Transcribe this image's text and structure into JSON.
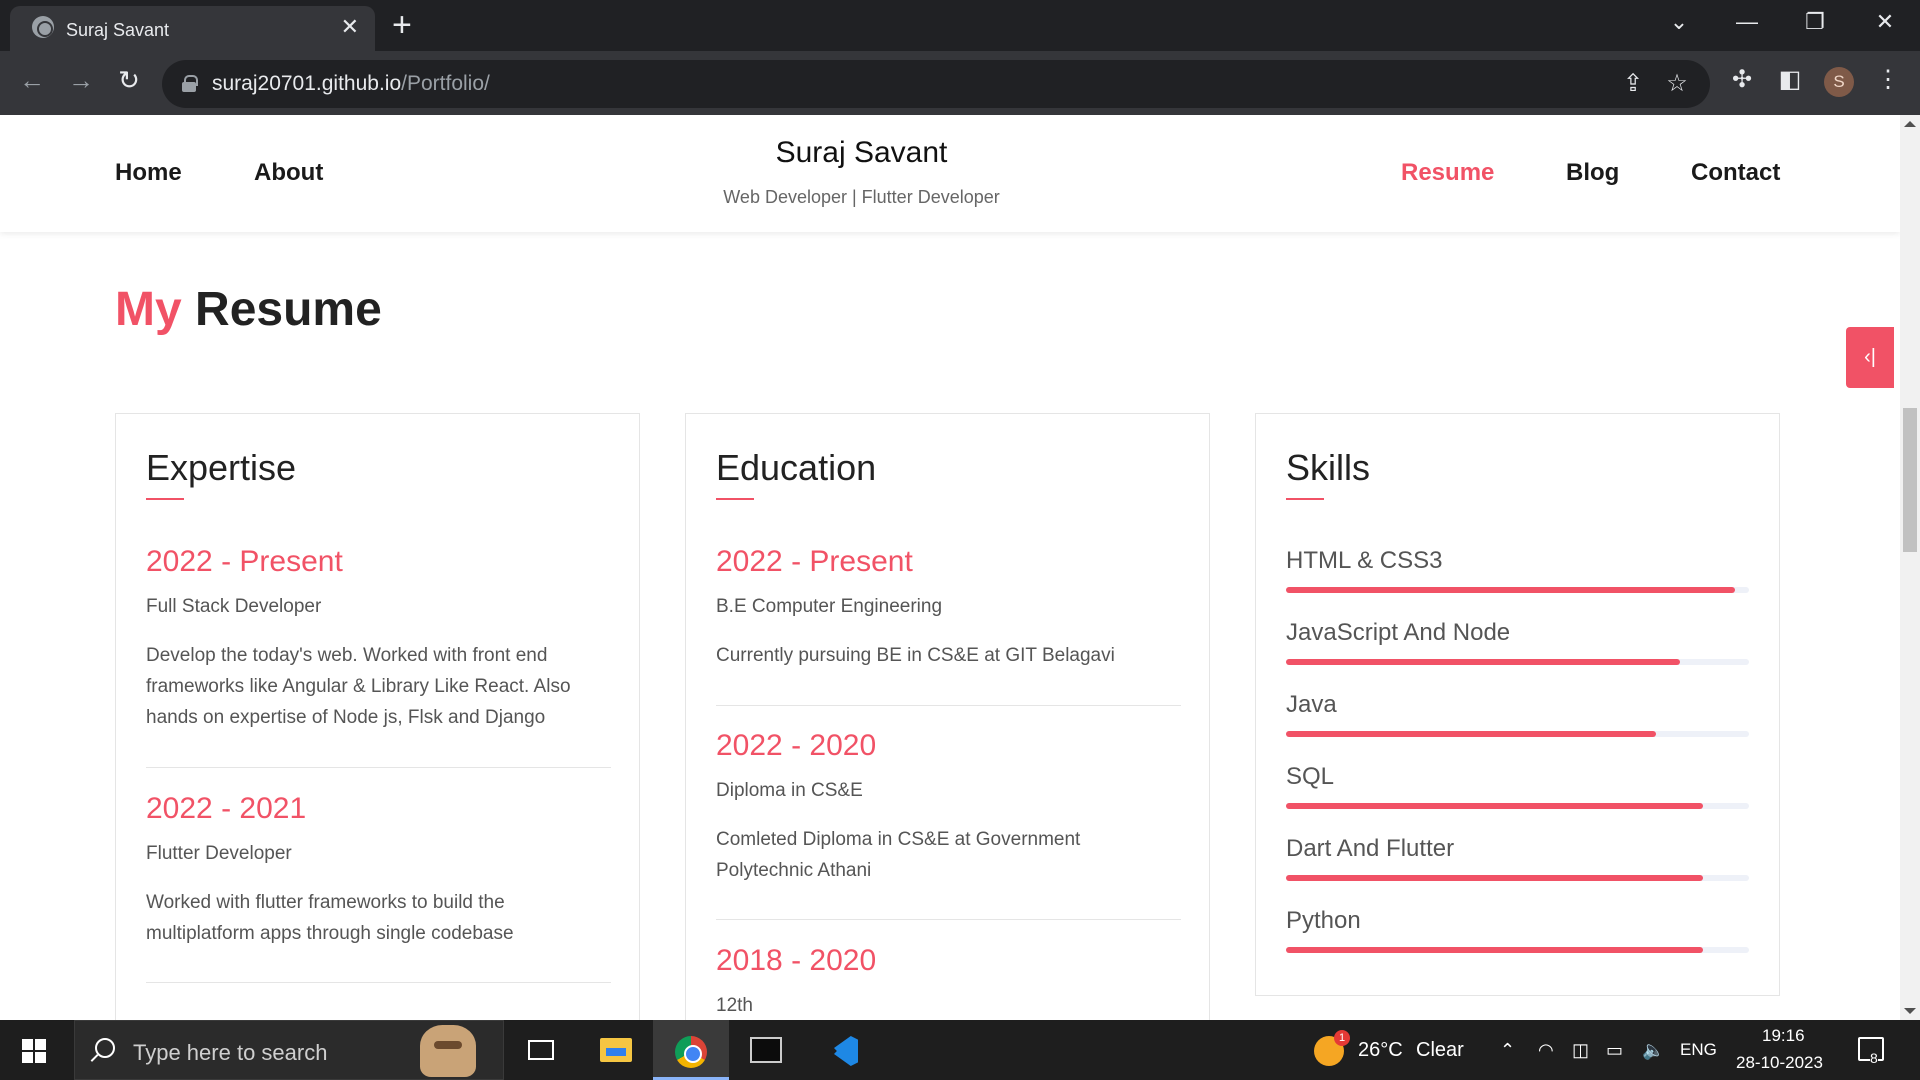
{
  "browser": {
    "tab_title": "Suraj Savant",
    "url_domain": "suraj20701.github.io",
    "url_path": "/Portfolio/",
    "profile_initial": "S"
  },
  "site": {
    "brand_name": "Suraj Savant",
    "brand_sub": "Web Developer | Flutter Developer",
    "nav": {
      "home": "Home",
      "about": "About",
      "resume": "Resume",
      "blog": "Blog",
      "contact": "Contact"
    },
    "section_title_accent": "My",
    "section_title_rest": "Resume",
    "accent_color": "#f15266"
  },
  "expertise": {
    "title": "Expertise",
    "entries": [
      {
        "year": "2022 - Present",
        "role": "Full Stack Developer",
        "desc": "Develop the today's web. Worked with front end frameworks like Angular & Library Like React. Also hands on expertise of Node js, Flsk and Django"
      },
      {
        "year": "2022 - 2021",
        "role": "Flutter Developer",
        "desc": "Worked with flutter frameworks to build the multiplatform apps through single codebase"
      }
    ]
  },
  "education": {
    "title": "Education",
    "entries": [
      {
        "year": "2022 - Present",
        "role": "B.E Computer Engineering",
        "desc": "Currently pursuing BE in CS&E at GIT Belagavi"
      },
      {
        "year": "2022 - 2020",
        "role": "Diploma in CS&E",
        "desc": "Comleted Diploma in CS&E at Government Polytechnic Athani"
      },
      {
        "year": "2018 - 2020",
        "role": "12th",
        "desc": ""
      }
    ]
  },
  "skills": {
    "title": "Skills",
    "items": [
      {
        "name": "HTML & CSS3",
        "level": 0.97
      },
      {
        "name": "JavaScript And Node",
        "level": 0.85
      },
      {
        "name": "Java",
        "level": 0.8
      },
      {
        "name": "SQL",
        "level": 0.9
      },
      {
        "name": "Dart And Flutter",
        "level": 0.9
      },
      {
        "name": "Python",
        "level": 0.9
      }
    ]
  },
  "taskbar": {
    "search_placeholder": "Type here to search",
    "weather_temp": "26°C",
    "weather_desc": "Clear",
    "weather_badge": "1",
    "language": "ENG",
    "time": "19:16",
    "date": "28-10-2023",
    "notification_count": "8"
  }
}
